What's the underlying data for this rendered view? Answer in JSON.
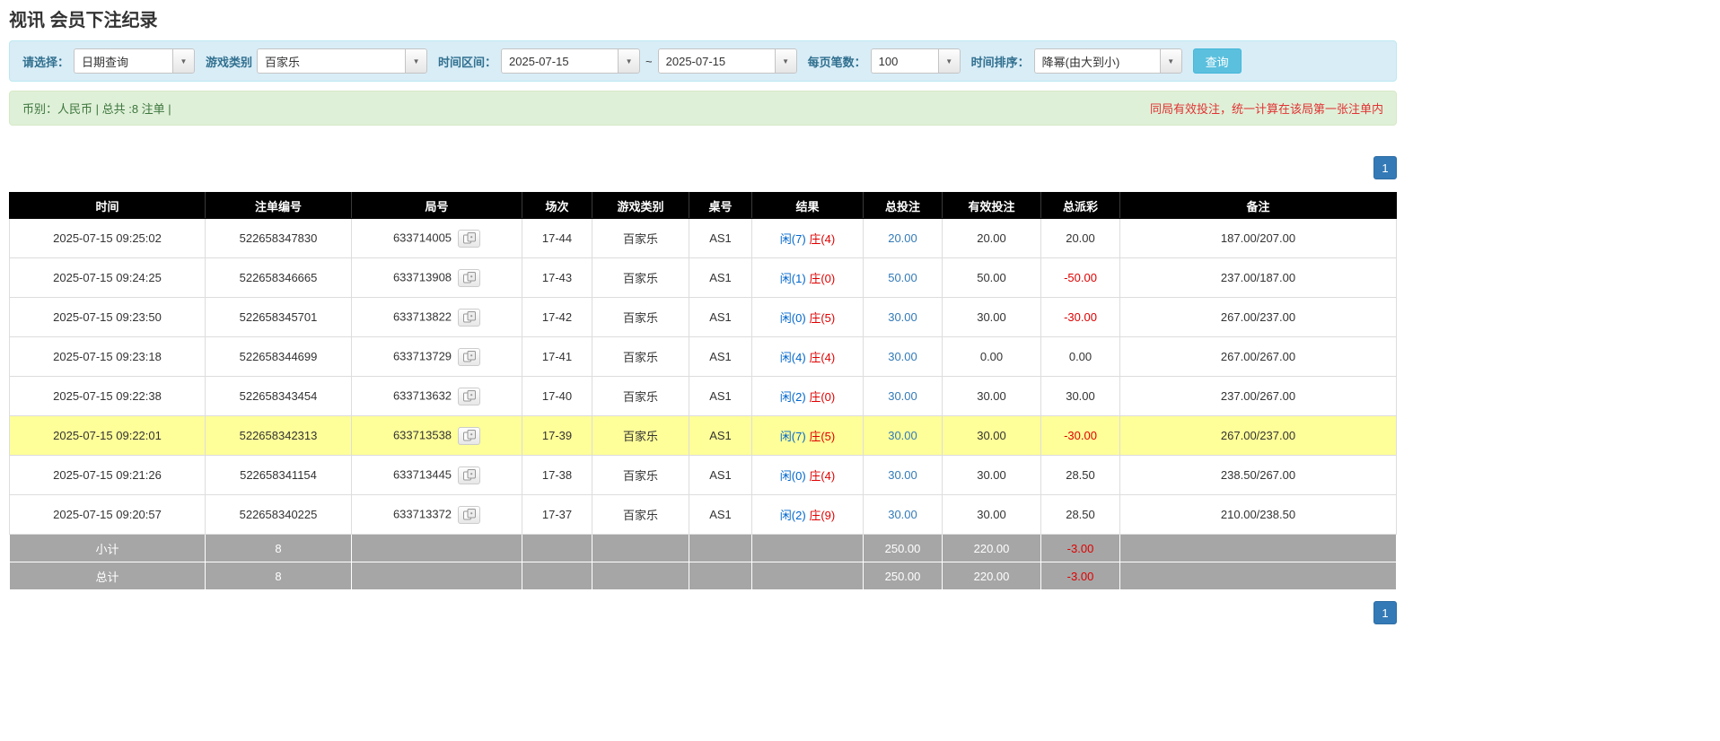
{
  "page": {
    "title": "视讯 会员下注纪录"
  },
  "filters": {
    "select_label": "请选择：",
    "select_value": "日期查询",
    "game_label": "游戏类别",
    "game_value": "百家乐",
    "range_label": "时间区间：",
    "date_from": "2025-07-15",
    "range_separator": "~",
    "date_to": "2025-07-15",
    "per_page_label": "每页笔数：",
    "per_page_value": "100",
    "sort_label": "时间排序：",
    "sort_value": "降幂(由大到小)",
    "search_button": "查询"
  },
  "summary": {
    "left": "币别：人民币 | 总共 :8 注单 |",
    "right": "同局有效投注，统一计算在该局第一张注单内"
  },
  "pagination": {
    "page": "1"
  },
  "colors": {
    "accent_blue": "#337ab7",
    "negative_red": "#e00000",
    "player_blue": "#0066cc",
    "banker_red": "#e00000",
    "highlight_yellow": "#ffff99",
    "header_black": "#000000",
    "footer_gray": "#a6a6a6"
  },
  "table": {
    "columns": [
      {
        "key": "time",
        "label": "时间"
      },
      {
        "key": "bet-id",
        "label": "注单编号"
      },
      {
        "key": "round-id",
        "label": "局号"
      },
      {
        "key": "session",
        "label": "场次"
      },
      {
        "key": "game-type",
        "label": "游戏类别"
      },
      {
        "key": "table-no",
        "label": "桌号"
      },
      {
        "key": "result",
        "label": "结果"
      },
      {
        "key": "total-bet",
        "label": "总投注"
      },
      {
        "key": "valid-bet",
        "label": "有效投注"
      },
      {
        "key": "total-payout",
        "label": "总派彩"
      },
      {
        "key": "note",
        "label": "备注"
      }
    ],
    "rows": [
      {
        "time": "2025-07-15 09:25:02",
        "bet_id": "522658347830",
        "round_id": "633714005",
        "session": "17-44",
        "game_type": "百家乐",
        "table_no": "AS1",
        "result_player": "闲(7)",
        "result_banker": "庄(4)",
        "total_bet": "20.00",
        "valid_bet": "20.00",
        "payout": "20.00",
        "note": "187.00/207.00",
        "highlight": false
      },
      {
        "time": "2025-07-15 09:24:25",
        "bet_id": "522658346665",
        "round_id": "633713908",
        "session": "17-43",
        "game_type": "百家乐",
        "table_no": "AS1",
        "result_player": "闲(1)",
        "result_banker": "庄(0)",
        "total_bet": "50.00",
        "valid_bet": "50.00",
        "payout": "-50.00",
        "note": "237.00/187.00",
        "highlight": false
      },
      {
        "time": "2025-07-15 09:23:50",
        "bet_id": "522658345701",
        "round_id": "633713822",
        "session": "17-42",
        "game_type": "百家乐",
        "table_no": "AS1",
        "result_player": "闲(0)",
        "result_banker": "庄(5)",
        "total_bet": "30.00",
        "valid_bet": "30.00",
        "payout": "-30.00",
        "note": "267.00/237.00",
        "highlight": false
      },
      {
        "time": "2025-07-15 09:23:18",
        "bet_id": "522658344699",
        "round_id": "633713729",
        "session": "17-41",
        "game_type": "百家乐",
        "table_no": "AS1",
        "result_player": "闲(4)",
        "result_banker": "庄(4)",
        "total_bet": "30.00",
        "valid_bet": "0.00",
        "payout": "0.00",
        "note": "267.00/267.00",
        "highlight": false
      },
      {
        "time": "2025-07-15 09:22:38",
        "bet_id": "522658343454",
        "round_id": "633713632",
        "session": "17-40",
        "game_type": "百家乐",
        "table_no": "AS1",
        "result_player": "闲(2)",
        "result_banker": "庄(0)",
        "total_bet": "30.00",
        "valid_bet": "30.00",
        "payout": "30.00",
        "note": "237.00/267.00",
        "highlight": false
      },
      {
        "time": "2025-07-15 09:22:01",
        "bet_id": "522658342313",
        "round_id": "633713538",
        "session": "17-39",
        "game_type": "百家乐",
        "table_no": "AS1",
        "result_player": "闲(7)",
        "result_banker": "庄(5)",
        "total_bet": "30.00",
        "valid_bet": "30.00",
        "payout": "-30.00",
        "note": "267.00/237.00",
        "highlight": true
      },
      {
        "time": "2025-07-15 09:21:26",
        "bet_id": "522658341154",
        "round_id": "633713445",
        "session": "17-38",
        "game_type": "百家乐",
        "table_no": "AS1",
        "result_player": "闲(0)",
        "result_banker": "庄(4)",
        "total_bet": "30.00",
        "valid_bet": "30.00",
        "payout": "28.50",
        "note": "238.50/267.00",
        "highlight": false
      },
      {
        "time": "2025-07-15 09:20:57",
        "bet_id": "522658340225",
        "round_id": "633713372",
        "session": "17-37",
        "game_type": "百家乐",
        "table_no": "AS1",
        "result_player": "闲(2)",
        "result_banker": "庄(9)",
        "total_bet": "30.00",
        "valid_bet": "30.00",
        "payout": "28.50",
        "note": "210.00/238.50",
        "highlight": false
      }
    ],
    "summary_rows": [
      {
        "label": "小计",
        "count": "8",
        "total_bet": "250.00",
        "valid_bet": "220.00",
        "payout": "-3.00"
      },
      {
        "label": "总计",
        "count": "8",
        "total_bet": "250.00",
        "valid_bet": "220.00",
        "payout": "-3.00"
      }
    ]
  }
}
